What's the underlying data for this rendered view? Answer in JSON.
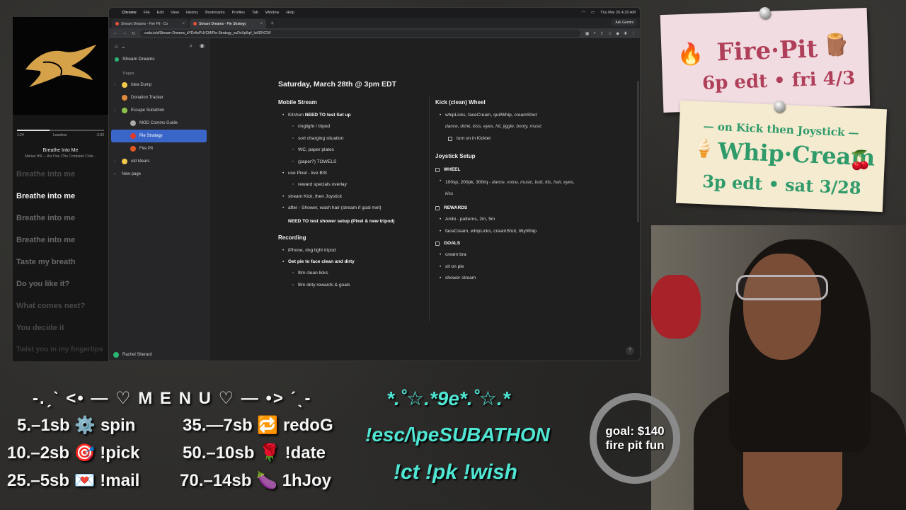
{
  "player": {
    "elapsed": "1:24",
    "quality": "Lossless",
    "remaining": "-2:32",
    "progress": 0.37,
    "track": "Breathe Into Me",
    "artist": "Marian Hill — Act One (The Complete Colle...",
    "lyrics": [
      {
        "text": "Breathe into me",
        "state": "dim"
      },
      {
        "text": "Breathe into me",
        "state": "active"
      },
      {
        "text": "Breathe into me",
        "state": ""
      },
      {
        "text": "Breathe into me",
        "state": ""
      },
      {
        "text": "Taste my breath",
        "state": ""
      },
      {
        "text": "Do you like it?",
        "state": ""
      },
      {
        "text": "What comes next?",
        "state": "dim"
      },
      {
        "text": "You decide it",
        "state": "dim"
      },
      {
        "text": "Twist you in my fingertips",
        "state": "faint"
      }
    ]
  },
  "menubar": {
    "app": "Chrome",
    "items": [
      "File",
      "Edit",
      "View",
      "History",
      "Bookmarks",
      "Profiles",
      "Tab",
      "Window",
      "Help"
    ],
    "clock": "Thu Mar 26  4:20 AM"
  },
  "tabs": [
    {
      "label": "Stream Dreams - Fire Pit - Co",
      "active": false
    },
    {
      "label": "Stream Dreams - Pie Strategy",
      "active": true
    }
  ],
  "ask_gemini": "Ask Gemini",
  "url": "coda.io/d/Stream-Dreams_dYDrAsPLKCM/Pie-Strategy_suDvXp6q#_lutSRXCW",
  "sidebar": {
    "doc_title": "Stream Dreams",
    "pages_label": "Pages",
    "items": [
      {
        "label": "Idea Dump",
        "indent": 0,
        "chev": "›",
        "color": "#f2c94c",
        "selected": false
      },
      {
        "label": "Donation Tracker",
        "indent": 0,
        "chev": "",
        "color": "#e08a3c",
        "selected": false
      },
      {
        "label": "Escape Subathon",
        "indent": 0,
        "chev": "⌄",
        "color": "#8bc34a",
        "selected": false
      },
      {
        "label": "MOD Comms Guide",
        "indent": 1,
        "chev": "",
        "color": "#aaaaaa",
        "selected": false
      },
      {
        "label": "Pie Strategy",
        "indent": 1,
        "chev": "",
        "color": "#dd3b2b",
        "selected": true
      },
      {
        "label": "Fire Pit",
        "indent": 1,
        "chev": "",
        "color": "#e25822",
        "selected": false
      },
      {
        "label": "old Idears",
        "indent": 0,
        "chev": "›",
        "color": "#f2c94c",
        "selected": false
      }
    ],
    "new_page": "New page",
    "user": "Rachel Sherard"
  },
  "doc": {
    "heading": "Saturday, March 28th @ 3pm EDT",
    "mobile": {
      "title": "Mobile Stream",
      "kitchen_prefix": "Kitchen ",
      "kitchen_bold": "NEED TO test Set up",
      "kitchen_subs": [
        "ringlight / tripod",
        "sort charging situation",
        "WC, paper plates",
        "(paper?) TOWELS"
      ],
      "pixel": "use Pixel - live BtS",
      "pixel_subs": [
        "reward specials overlay"
      ],
      "kick": "stream Kick, then Joystick",
      "after": "after - Shower, wash hair (stream if goal met)",
      "shower_note": "NEED TO test shower setup (Pixel & new tripod)"
    },
    "recording": {
      "title": "Recording",
      "items": [
        "iPhone, ring light tripod"
      ],
      "pie_bold": "Get pie to face clean and dirty",
      "pie_subs": [
        "film clean licks",
        "film dirty rewards & goals"
      ]
    },
    "kick_wheel": {
      "title": "Kick (clean) Wheel",
      "item": "whipLicks, faceCream, quitWhip, creamShot",
      "ital": "dance, drink, kiss, eyes, hit, jiggle, booty, music",
      "check": "turn on in  Kicklet"
    },
    "joystick": {
      "title": "Joystick Setup",
      "wheel": "WHEEL",
      "wheel_prefix": "100sp, 200pk, 300rq - ",
      "wheel_ital": "dance, voice, music, butt, tits, hair, eyes, kiss",
      "rewards": "REWARDS",
      "rewards_items": [
        "Ambi - patterns, 2m, 5m",
        "faceCream, whipLicks, creamShot, tittyWhip"
      ],
      "goals": "GOALS",
      "goals_items": [
        "cream bra",
        "sit on pie",
        "shower stream"
      ]
    },
    "help": "?"
  },
  "note_fire": {
    "title": "Fire·Pit",
    "when": "6p edt • fri 4/3"
  },
  "note_whip": {
    "lead": "— on Kick then Joystick —",
    "title": "Whip·Cream",
    "when": "3p edt • sat 3/28"
  },
  "menu": {
    "title": "-.ˏˋ <• — ♡ M E N U ♡ — •> ˊˎ-",
    "left": [
      "5.–1sb ⚙️ spin",
      "10.–2sb 🎯 !pick",
      "25.–5sb 💌 !mail"
    ],
    "right": [
      "35.—7sb 🔁 redoG",
      "50.–10sb 🌹 !date",
      "70.–14sb 🍆 1hJoy"
    ]
  },
  "subathon": {
    "stars": "*.˚☆.*9e*.˚☆.*",
    "title": "!esc/\\peSUBATHON",
    "commands": "!ct !pk !wish"
  },
  "goal": {
    "line1": "goal: $140",
    "line2": "fire pit fun"
  }
}
